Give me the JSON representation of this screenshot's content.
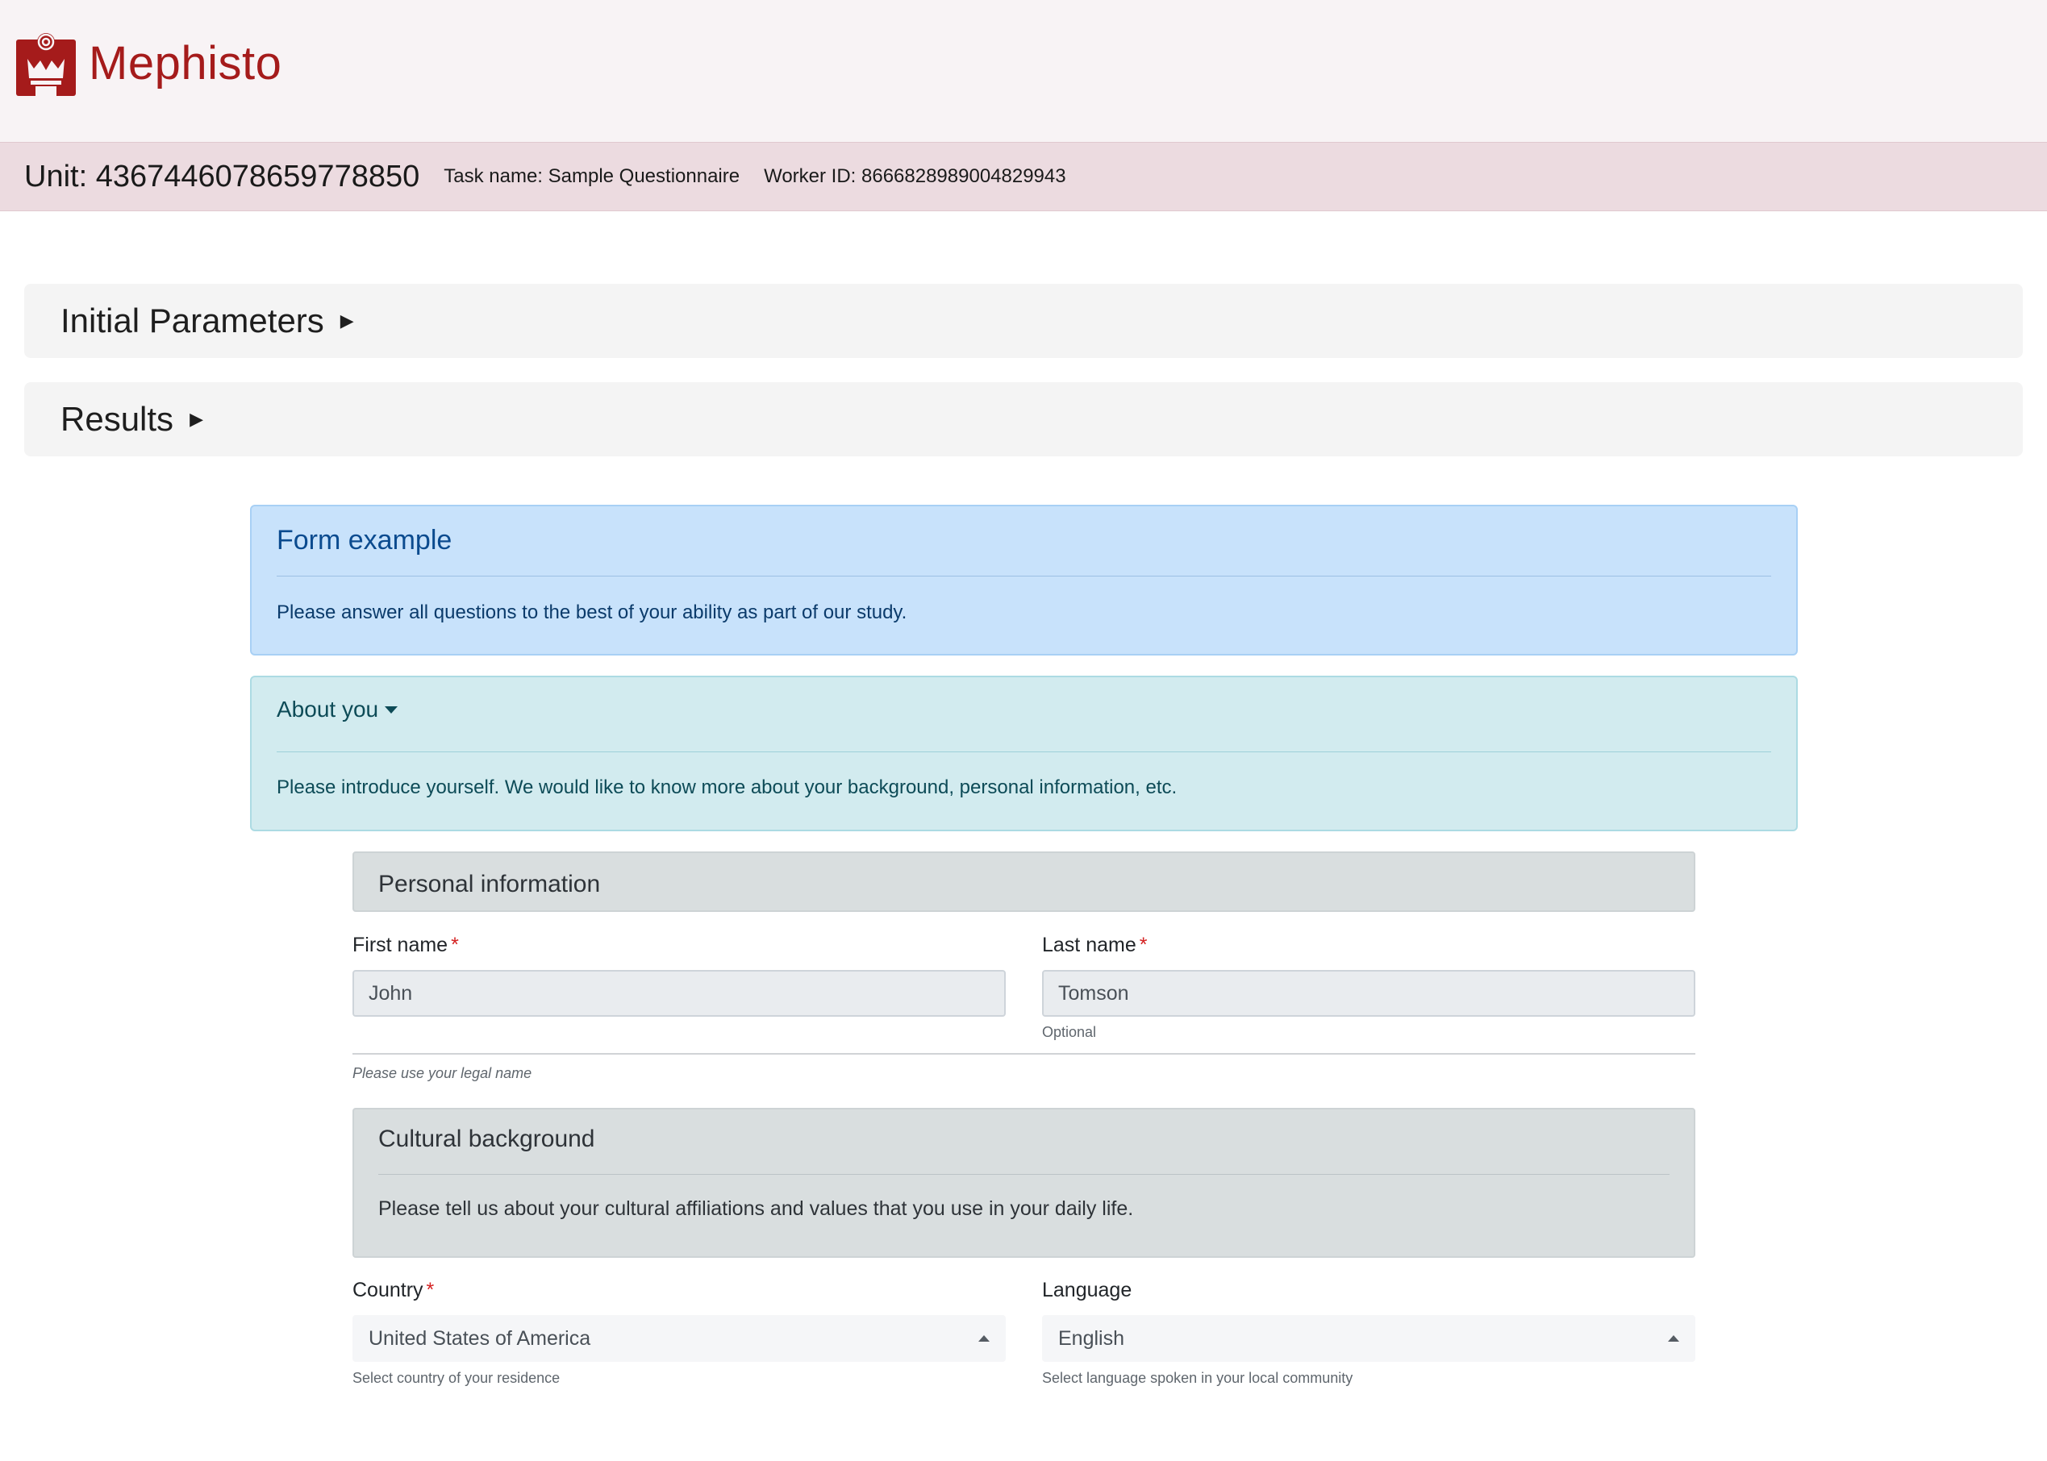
{
  "brand": {
    "name": "Mephisto",
    "color": "#a51b1b"
  },
  "unit_bar": {
    "unit": "Unit: 4367446078659778850",
    "task_name": "Task name: Sample Questionnaire",
    "worker_id": "Worker ID: 8666828989004829943"
  },
  "panels": {
    "initial_parameters": {
      "title": "Initial Parameters",
      "arrow": "▶"
    },
    "results": {
      "title": "Results",
      "arrow": "▶"
    }
  },
  "form": {
    "title": "Form example",
    "instructions": "Please answer all questions to the best of your ability as part of our study."
  },
  "about": {
    "title": "About you",
    "text": "Please introduce yourself. We would like to know more about your background, personal information, etc."
  },
  "personal": {
    "title": "Personal information",
    "first_name": {
      "label": "First name",
      "required_mark": "*",
      "value": "John"
    },
    "last_name": {
      "label": "Last name",
      "required_mark": "*",
      "value": "Tomson",
      "help": "Optional"
    },
    "section_help": "Please use your legal name"
  },
  "cultural": {
    "title": "Cultural background",
    "text": "Please tell us about your cultural affiliations and values that you use in your daily life.",
    "country": {
      "label": "Country",
      "required_mark": "*",
      "value": "United States of America",
      "help": "Select country of your residence"
    },
    "language": {
      "label": "Language",
      "value": "English",
      "help": "Select language spoken in your local community"
    }
  }
}
